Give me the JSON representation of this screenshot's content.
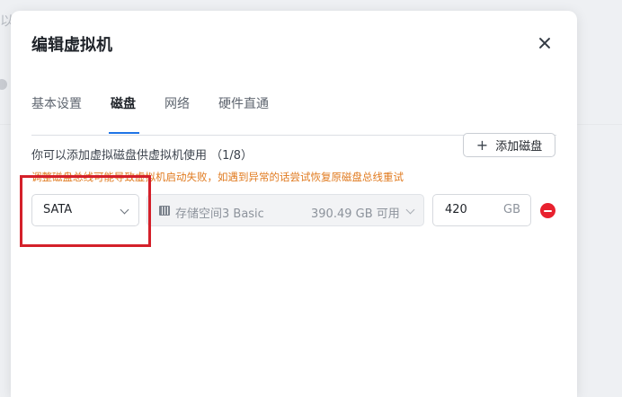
{
  "background": {
    "partial_text": "以"
  },
  "dialog": {
    "title": "编辑虚拟机",
    "tabs": [
      {
        "label": "基本设置",
        "active": false
      },
      {
        "label": "磁盘",
        "active": true
      },
      {
        "label": "网络",
        "active": false
      },
      {
        "label": "硬件直通",
        "active": false
      }
    ],
    "disk_info": "你可以添加虚拟磁盘供虚拟机使用 （1/8）",
    "add_disk_label": "添加磁盘",
    "warning": "调整磁盘总线可能导致虚拟机启动失败，如遇到异常的话尝试恢复原磁盘总线重试",
    "disk": {
      "bus": "SATA",
      "storage_name": "存储空间3 Basic",
      "storage_free": "390.49 GB 可用",
      "size_value": "420",
      "size_unit": "GB"
    }
  },
  "colors": {
    "accent": "#1f74e6",
    "warning": "#e07a1f",
    "danger": "#e8212e",
    "highlight_box": "#d4202a"
  },
  "icons": [
    "close-icon",
    "plus-icon",
    "chevron-down-icon",
    "disk-storage-icon",
    "remove-icon"
  ]
}
